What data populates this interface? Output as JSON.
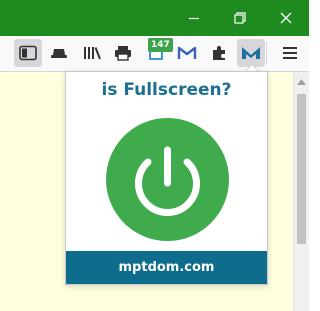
{
  "window": {
    "accent": "#1f8a1f",
    "controls": [
      "minimize-icon",
      "restore-icon",
      "close-icon"
    ]
  },
  "toolbar": {
    "items": [
      "sidebar-icon",
      "toolbar-cap-icon",
      "library-icon",
      "print-icon",
      "extension-tab-counter-icon",
      "gmail-icon",
      "extensions-puzzle-icon",
      "mptdom-icon",
      "menu-icon"
    ],
    "badge": "147"
  },
  "popup": {
    "title": "is Fullscreen?",
    "footer": "mptdom.com",
    "power_color": "#3fab4d",
    "footer_color": "#0e6d8c",
    "title_color": "#1b6f91"
  },
  "page": {
    "background": "#ffffe0"
  }
}
